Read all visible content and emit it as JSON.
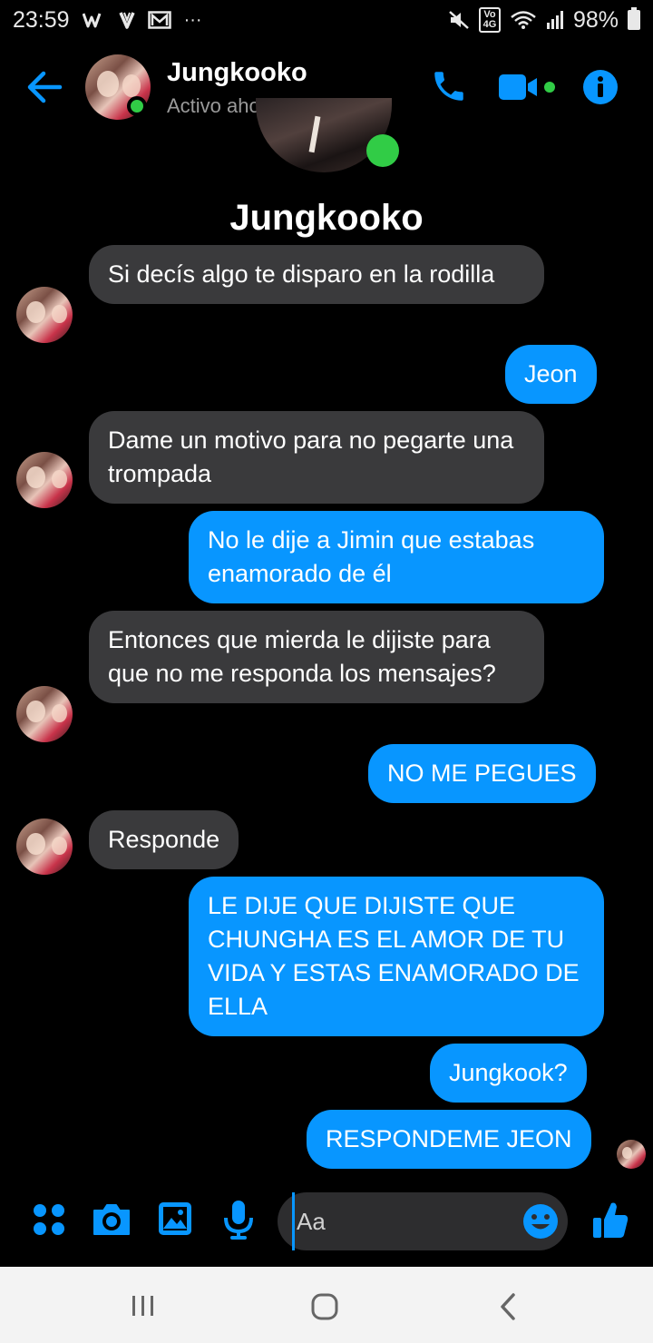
{
  "status_bar": {
    "time": "23:59",
    "notif_icons": [
      "w-icon",
      "v-icon",
      "mail-icon"
    ],
    "more": "···",
    "network_badge": "Vo 4G",
    "battery": "98%"
  },
  "header": {
    "contact_name": "Jungkooko",
    "status": "Activo ahora",
    "accent": "#0896ff",
    "online_color": "#31cc46"
  },
  "profile": {
    "name": "Jungkooko"
  },
  "messages": [
    {
      "side": "in",
      "text": "Si decís algo te disparo en la rodilla"
    },
    {
      "side": "out",
      "text": "Jeon"
    },
    {
      "side": "in",
      "text": "Dame un motivo para no pegarte una trompada"
    },
    {
      "side": "out",
      "text": "No le dije a Jimin que estabas enamorado de él"
    },
    {
      "side": "in",
      "text": "Entonces que mierda le dijiste para que no me responda los mensajes?"
    },
    {
      "side": "out",
      "text": "NO ME PEGUES"
    },
    {
      "side": "in",
      "text": "Responde"
    },
    {
      "side": "out",
      "text": "LE DIJE QUE DIJISTE QUE CHUNGHA ES EL AMOR DE TU VIDA Y ESTAS ENAMORADO DE ELLA"
    },
    {
      "side": "out",
      "text": "Jungkook?"
    },
    {
      "side": "out",
      "text": "RESPONDEME JEON"
    }
  ],
  "composer": {
    "placeholder": "Aa",
    "buttons": [
      "menu-icon",
      "camera-icon",
      "gallery-icon",
      "microphone-icon",
      "emoji-icon",
      "like-icon"
    ]
  },
  "nav_bar": {
    "buttons": [
      "recents-icon",
      "home-icon",
      "back-icon"
    ]
  }
}
